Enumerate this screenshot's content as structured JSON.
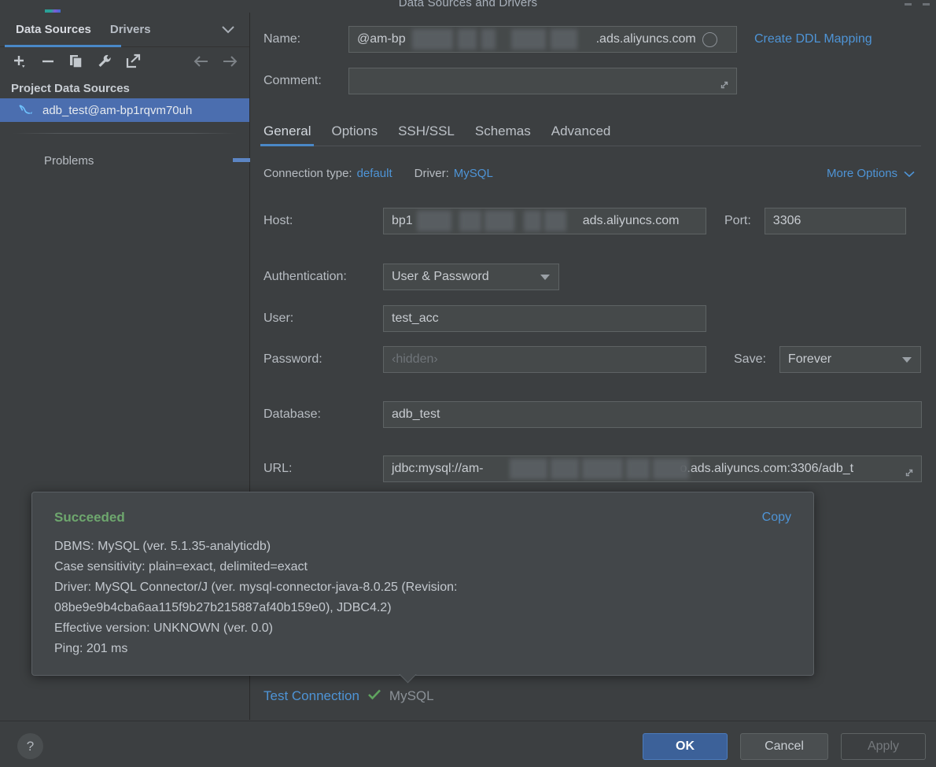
{
  "window": {
    "title": "Data Sources and Drivers"
  },
  "sidebar": {
    "tabs": [
      {
        "label": "Data Sources",
        "active": true
      },
      {
        "label": "Drivers",
        "active": false
      }
    ],
    "chevron_icon": "chevron-down-icon",
    "toolbar": [
      {
        "name": "add-button",
        "icon": "plus-icon"
      },
      {
        "name": "remove-button",
        "icon": "minus-icon"
      },
      {
        "name": "duplicate-button",
        "icon": "copy-icon"
      },
      {
        "name": "properties-button",
        "icon": "wrench-icon"
      },
      {
        "name": "open-external-button",
        "icon": "external-link-icon"
      },
      {
        "name": "back-button",
        "icon": "arrow-left-icon"
      },
      {
        "name": "forward-button",
        "icon": "arrow-right-icon"
      }
    ],
    "group_label": "Project Data Sources",
    "items": [
      {
        "label": "adb_test@am-bp1rqvm70uh",
        "icon": "mysql-dolphin-icon",
        "selected": true
      }
    ],
    "problems_label": "Problems"
  },
  "form": {
    "name_label": "Name:",
    "name_value_prefix": "@am-bp",
    "name_value_suffix": ".ads.aliyuncs.com",
    "create_ddl_mapping": "Create DDL Mapping",
    "comment_label": "Comment:",
    "comment_value": "",
    "tabs": [
      {
        "label": "General",
        "active": true
      },
      {
        "label": "Options",
        "active": false
      },
      {
        "label": "SSH/SSL",
        "active": false
      },
      {
        "label": "Schemas",
        "active": false
      },
      {
        "label": "Advanced",
        "active": false
      }
    ],
    "connection_type_label": "Connection type:",
    "connection_type_value": "default",
    "driver_label": "Driver:",
    "driver_value": "MySQL",
    "more_options": "More Options",
    "host_label": "Host:",
    "host_value_prefix": "bp1",
    "host_value_suffix": "ads.aliyuncs.com",
    "port_label": "Port:",
    "port_value": "3306",
    "authentication_label": "Authentication:",
    "authentication_value": "User & Password",
    "user_label": "User:",
    "user_value": "test_acc",
    "password_label": "Password:",
    "password_placeholder": "‹hidden›",
    "save_label": "Save:",
    "save_value": "Forever",
    "database_label": "Database:",
    "database_value": "adb_test",
    "url_label": "URL:",
    "url_value_prefix": "jdbc:mysql://am-",
    "url_value_suffix": "o.ads.aliyuncs.com:3306/adb_t"
  },
  "popup": {
    "status": "Succeeded",
    "copy_label": "Copy",
    "lines": [
      "DBMS: MySQL (ver. 5.1.35-analyticdb)",
      "Case sensitivity: plain=exact, delimited=exact",
      "Driver: MySQL Connector/J (ver. mysql-connector-java-8.0.25 (Revision:",
      "08be9e9b4cba6aa115f9b27b215887af40b159e0), JDBC4.2)",
      "Effective version: UNKNOWN (ver. 0.0)",
      "Ping: 201 ms"
    ]
  },
  "test_connection": {
    "label": "Test Connection",
    "check_icon": "check-icon",
    "driver_name": "MySQL"
  },
  "footer": {
    "help_label": "?",
    "ok_label": "OK",
    "cancel_label": "Cancel",
    "apply_label": "Apply"
  },
  "colors": {
    "background": "#3c3f41",
    "accent_blue": "#4a88c7",
    "link_blue": "#4e94d6",
    "selection_blue": "#4b6eaf",
    "success_green": "#6ea76e",
    "ok_button": "#3c6199"
  }
}
